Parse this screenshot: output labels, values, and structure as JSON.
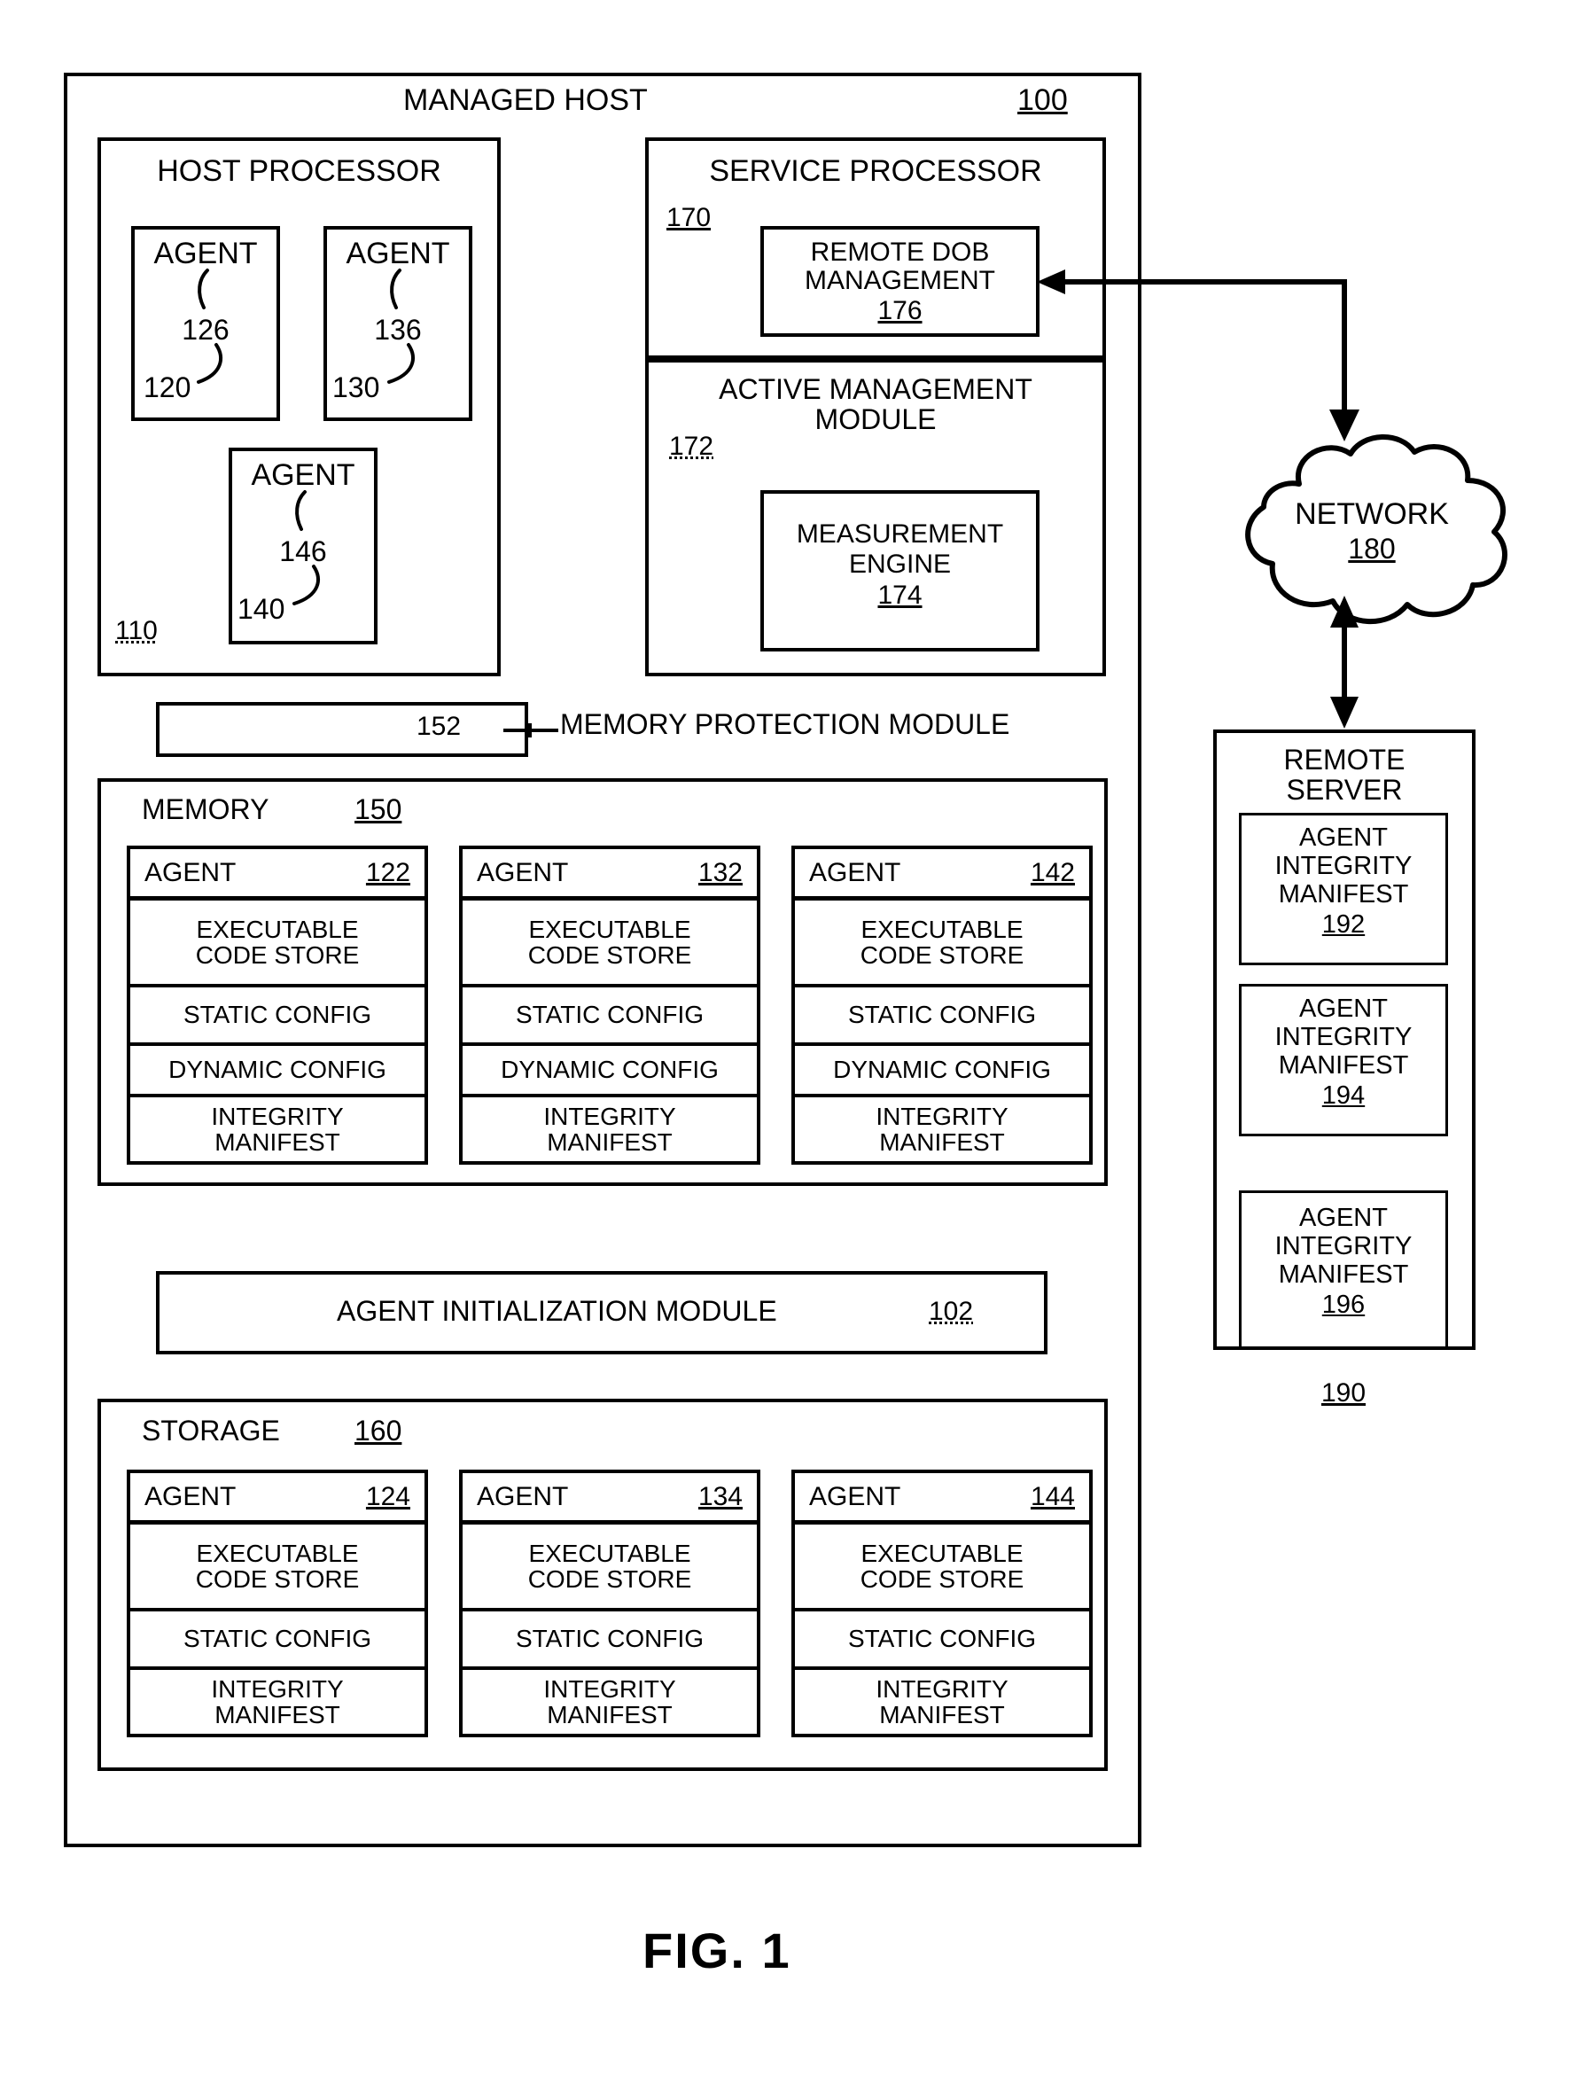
{
  "figure": {
    "caption": "FIG. 1"
  },
  "managed_host": {
    "title": "MANAGED HOST",
    "ref": "100"
  },
  "host_processor": {
    "title": "HOST PROCESSOR",
    "ref": "110",
    "agents": [
      {
        "label": "AGENT",
        "inner_ref": "126",
        "outer_ref": "120"
      },
      {
        "label": "AGENT",
        "inner_ref": "136",
        "outer_ref": "130"
      },
      {
        "label": "AGENT",
        "inner_ref": "146",
        "outer_ref": "140"
      }
    ]
  },
  "service_processor": {
    "title": "SERVICE PROCESSOR",
    "ref": "170",
    "remote_dob": {
      "line1": "REMOTE DOB",
      "line2": "MANAGEMENT",
      "ref": "176"
    },
    "active_management": {
      "line1": "ACTIVE MANAGEMENT",
      "line2": "MODULE",
      "ref": "172",
      "measurement_engine": {
        "line1": "MEASUREMENT",
        "line2": "ENGINE",
        "ref": "174"
      }
    }
  },
  "memory_protection": {
    "box_ref": "152",
    "label": "MEMORY PROTECTION MODULE"
  },
  "memory": {
    "title": "MEMORY",
    "ref": "150",
    "agents": [
      {
        "label": "AGENT",
        "ref": "122",
        "rows": [
          "EXECUTABLE\nCODE STORE",
          "STATIC CONFIG",
          "DYNAMIC CONFIG",
          "INTEGRITY\nMANIFEST"
        ]
      },
      {
        "label": "AGENT",
        "ref": "132",
        "rows": [
          "EXECUTABLE\nCODE STORE",
          "STATIC CONFIG",
          "DYNAMIC CONFIG",
          "INTEGRITY\nMANIFEST"
        ]
      },
      {
        "label": "AGENT",
        "ref": "142",
        "rows": [
          "EXECUTABLE\nCODE STORE",
          "STATIC CONFIG",
          "DYNAMIC CONFIG",
          "INTEGRITY\nMANIFEST"
        ]
      }
    ]
  },
  "agent_initialization": {
    "label": "AGENT INITIALIZATION MODULE",
    "ref": "102"
  },
  "storage": {
    "title": "STORAGE",
    "ref": "160",
    "agents": [
      {
        "label": "AGENT",
        "ref": "124",
        "rows": [
          "EXECUTABLE\nCODE STORE",
          "STATIC CONFIG",
          "INTEGRITY\nMANIFEST"
        ]
      },
      {
        "label": "AGENT",
        "ref": "134",
        "rows": [
          "EXECUTABLE\nCODE STORE",
          "STATIC CONFIG",
          "INTEGRITY\nMANIFEST"
        ]
      },
      {
        "label": "AGENT",
        "ref": "144",
        "rows": [
          "EXECUTABLE\nCODE STORE",
          "STATIC CONFIG",
          "INTEGRITY\nMANIFEST"
        ]
      }
    ]
  },
  "network": {
    "label": "NETWORK",
    "ref": "180"
  },
  "remote_server": {
    "line1": "REMOTE",
    "line2": "SERVER",
    "ref": "190",
    "manifests": [
      {
        "line1": "AGENT",
        "line2": "INTEGRITY",
        "line3": "MANIFEST",
        "ref": "192"
      },
      {
        "line1": "AGENT",
        "line2": "INTEGRITY",
        "line3": "MANIFEST",
        "ref": "194"
      },
      {
        "line1": "AGENT",
        "line2": "INTEGRITY",
        "line3": "MANIFEST",
        "ref": "196"
      }
    ]
  },
  "colors": {
    "ink": "#000000",
    "paper": "#ffffff"
  }
}
